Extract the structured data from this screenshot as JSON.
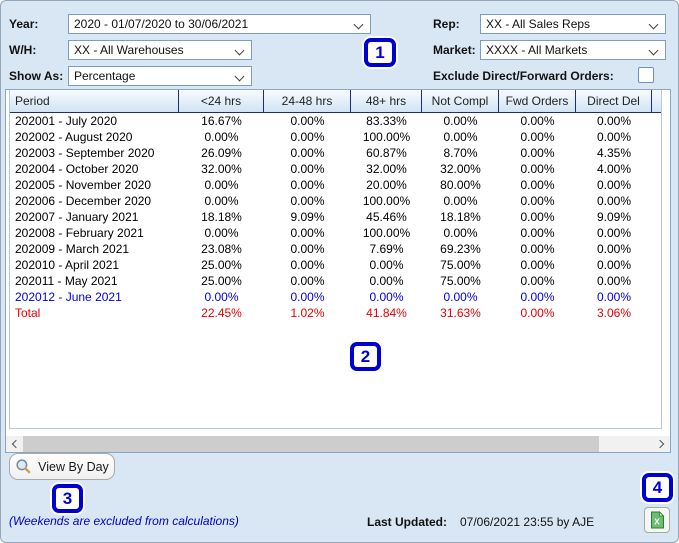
{
  "filters": {
    "year": {
      "label": "Year:",
      "value": "2020 - 01/07/2020 to 30/06/2021"
    },
    "warehouse": {
      "label": "W/H:",
      "value": "XX - All Warehouses"
    },
    "show_as": {
      "label": "Show As:",
      "value": "Percentage"
    },
    "rep": {
      "label": "Rep:",
      "value": "XX - All Sales Reps"
    },
    "market": {
      "label": "Market:",
      "value": "XXXX - All Markets"
    },
    "exclude_orders": {
      "label": "Exclude Direct/Forward Orders:",
      "checked": false
    }
  },
  "table": {
    "columns": [
      "Period",
      "<24 hrs",
      "24-48 hrs",
      "48+ hrs",
      "Not Compl",
      "Fwd Orders",
      "Direct Del"
    ],
    "rows": [
      {
        "period": "202001 - July 2020",
        "values": [
          "16.67%",
          "0.00%",
          "83.33%",
          "0.00%",
          "0.00%",
          "0.00%"
        ],
        "style": "normal"
      },
      {
        "period": "202002 - August 2020",
        "values": [
          "0.00%",
          "0.00%",
          "100.00%",
          "0.00%",
          "0.00%",
          "0.00%"
        ],
        "style": "normal"
      },
      {
        "period": "202003 - September 2020",
        "values": [
          "26.09%",
          "0.00%",
          "60.87%",
          "8.70%",
          "0.00%",
          "4.35%"
        ],
        "style": "normal"
      },
      {
        "period": "202004 - October 2020",
        "values": [
          "32.00%",
          "0.00%",
          "32.00%",
          "32.00%",
          "0.00%",
          "4.00%"
        ],
        "style": "normal"
      },
      {
        "period": "202005 - November 2020",
        "values": [
          "0.00%",
          "0.00%",
          "20.00%",
          "80.00%",
          "0.00%",
          "0.00%"
        ],
        "style": "normal"
      },
      {
        "period": "202006 - December 2020",
        "values": [
          "0.00%",
          "0.00%",
          "100.00%",
          "0.00%",
          "0.00%",
          "0.00%"
        ],
        "style": "normal"
      },
      {
        "period": "202007 - January 2021",
        "values": [
          "18.18%",
          "9.09%",
          "45.46%",
          "18.18%",
          "0.00%",
          "9.09%"
        ],
        "style": "normal"
      },
      {
        "period": "202008 - February 2021",
        "values": [
          "0.00%",
          "0.00%",
          "100.00%",
          "0.00%",
          "0.00%",
          "0.00%"
        ],
        "style": "normal"
      },
      {
        "period": "202009 - March 2021",
        "values": [
          "23.08%",
          "0.00%",
          "7.69%",
          "69.23%",
          "0.00%",
          "0.00%"
        ],
        "style": "normal"
      },
      {
        "period": "202010 - April 2021",
        "values": [
          "25.00%",
          "0.00%",
          "0.00%",
          "75.00%",
          "0.00%",
          "0.00%"
        ],
        "style": "normal"
      },
      {
        "period": "202011 - May 2021",
        "values": [
          "25.00%",
          "0.00%",
          "0.00%",
          "75.00%",
          "0.00%",
          "0.00%"
        ],
        "style": "normal"
      },
      {
        "period": "202012 - June 2021",
        "values": [
          "0.00%",
          "0.00%",
          "0.00%",
          "0.00%",
          "0.00%",
          "0.00%"
        ],
        "style": "current"
      },
      {
        "period": "Total",
        "values": [
          "22.45%",
          "1.02%",
          "41.84%",
          "31.63%",
          "0.00%",
          "3.06%"
        ],
        "style": "total"
      }
    ]
  },
  "annotations": [
    {
      "label": "1"
    },
    {
      "label": "2"
    },
    {
      "label": "3"
    },
    {
      "label": "4"
    }
  ],
  "footer": {
    "view_by_day": "View By Day",
    "note": "(Weekends are excluded from calculations)",
    "last_updated_label": "Last Updated:",
    "last_updated_value": "07/06/2021 23:55 by AJE"
  },
  "icons": {
    "magnifier": "magnifier-icon",
    "excel": "excel-export-icon",
    "combo_chevron": "chevron-down-icon"
  },
  "colors": {
    "background": "#d9e7f5",
    "callout_blue": "#0000cf",
    "current_period_blue": "#0000e0",
    "total_red": "#e60000",
    "note_blue": "#0000cc",
    "header_separator_navy": "#1d2f6e"
  }
}
